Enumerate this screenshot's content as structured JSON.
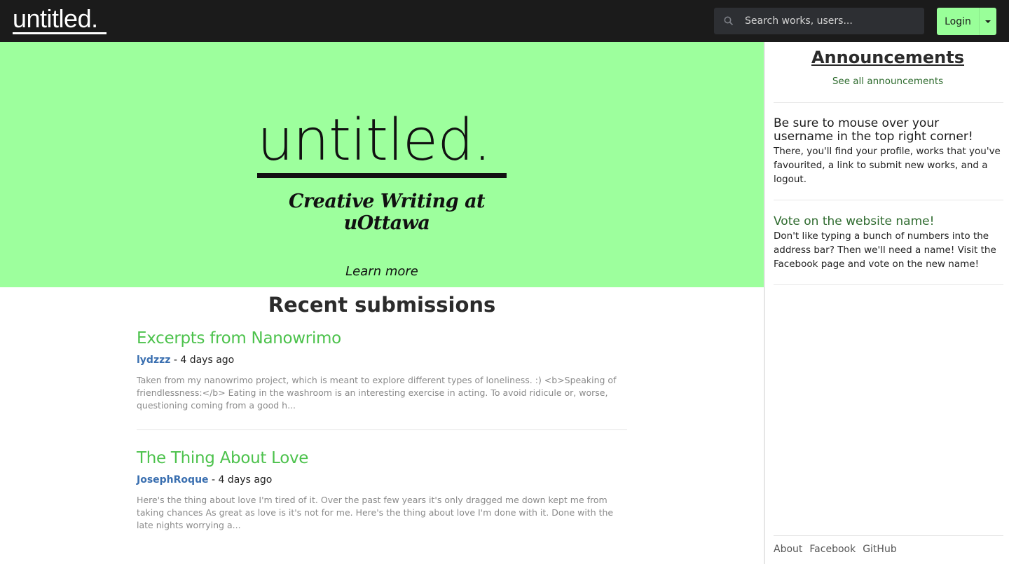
{
  "navbar": {
    "brand": "untitled.",
    "search_placeholder": "Search works, users...",
    "login_label": "Login"
  },
  "hero": {
    "title": "untitled.",
    "subtitle": "Creative Writing at uOttawa",
    "learn_more": "Learn more",
    "background": "#9dff9d"
  },
  "recent": {
    "heading": "Recent submissions",
    "items": [
      {
        "title": "Excerpts from Nanowrimo",
        "author": "lydzzz",
        "time": " - 4 days ago",
        "excerpt": "Taken from my nanowrimo project, which is meant to explore different types of loneliness. :) <b>Speaking of friendlessness:</b> Eating in the washroom is an interesting exercise in acting. To avoid ridicule or, worse, questioning coming from a good h..."
      },
      {
        "title": "The Thing About Love",
        "author": "JosephRoque",
        "time": " - 4 days ago",
        "excerpt": "Here's the thing about love I'm tired of it. Over the past few years it's only dragged me down kept me from taking chances As great as love is it's not for me. Here's the thing about love I'm done with it. Done with the late nights worrying a..."
      }
    ]
  },
  "sidebar": {
    "heading": "Announcements",
    "see_all": "See all announcements",
    "announcements": [
      {
        "title": "Be sure to mouse over your username in the top right corner!",
        "body": "There, you'll find your profile, works that you've favourited, a link to submit new works, and a logout."
      },
      {
        "title": "Vote on the website name!",
        "body": "Don't like typing a bunch of numbers into the address bar? Then we'll need a name! Visit the Facebook page and vote on the new name!"
      }
    ],
    "footer": [
      "About",
      "Facebook",
      "GitHub"
    ]
  },
  "colors": {
    "accent_green": "#99ff99",
    "title_green": "#4cc24c",
    "author_blue": "#3a6fb0",
    "navbar_bg": "#1b1b1b"
  }
}
